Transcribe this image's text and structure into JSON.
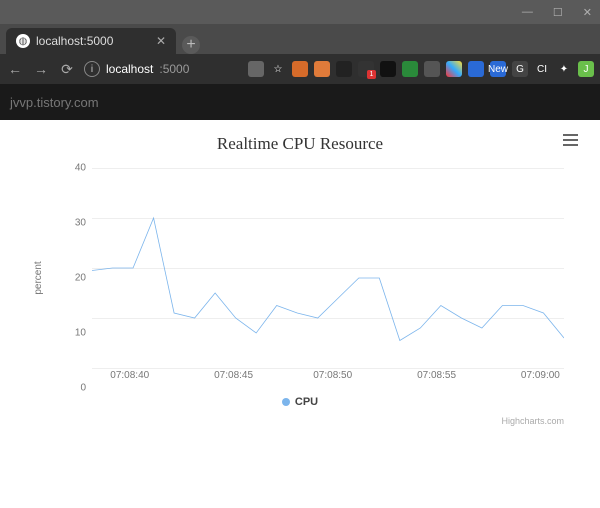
{
  "window_controls": {
    "min": "—",
    "max": "☐",
    "close": "✕"
  },
  "tab": {
    "title": "localhost:5000",
    "close": "✕"
  },
  "nav": {
    "back": "←",
    "forward": "→",
    "reload": "⟳"
  },
  "address": {
    "host": "localhost",
    "port": ":5000"
  },
  "extensions": {
    "star": "☆",
    "new_label": "New",
    "ci": "CI",
    "puzzle": "✦",
    "user": "J",
    "g": "G"
  },
  "banner": {
    "text": "jvvp.tistory.com"
  },
  "chart": {
    "title": "Realtime CPU Resource",
    "ylabel": "percent",
    "legend": "CPU",
    "credits": "Highcharts.com",
    "yticks": [
      "0",
      "10",
      "20",
      "30",
      "40"
    ],
    "xticks": [
      "07:08:40",
      "07:08:45",
      "07:08:50",
      "07:08:55",
      "07:09:00"
    ]
  },
  "chart_data": {
    "type": "line",
    "title": "Realtime CPU Resource",
    "xlabel": "",
    "ylabel": "percent",
    "ylim": [
      0,
      40
    ],
    "x_tick_labels": [
      "07:08:40",
      "07:08:45",
      "07:08:50",
      "07:08:55",
      "07:09:00"
    ],
    "series": [
      {
        "name": "CPU",
        "color": "#7cb5ec",
        "x_seconds_from_start": [
          0,
          1,
          2,
          3,
          4,
          5,
          6,
          7,
          8,
          9,
          10,
          11,
          12,
          13,
          14,
          15,
          16,
          17,
          18,
          19,
          20,
          21,
          22,
          23
        ],
        "values": [
          19.5,
          20,
          20,
          30,
          11,
          10,
          15,
          10,
          7,
          12.5,
          11,
          10,
          14,
          18,
          18,
          5.5,
          8,
          12.5,
          10,
          8,
          12.5,
          12.5,
          11,
          6
        ]
      }
    ]
  }
}
